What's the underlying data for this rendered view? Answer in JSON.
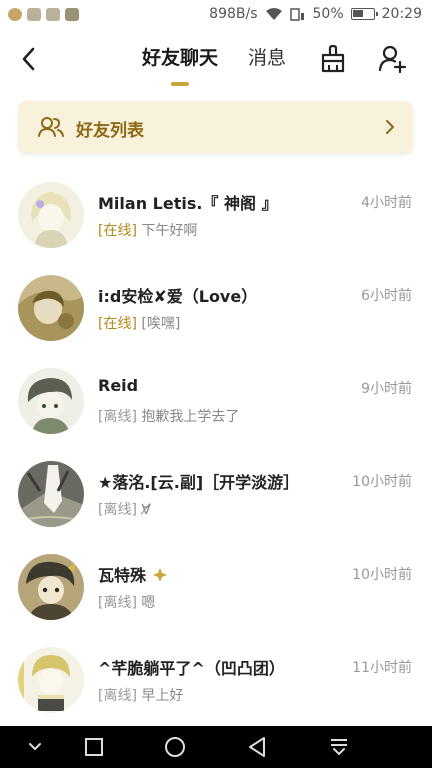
{
  "status_bar": {
    "speed": "898B/s",
    "battery": "50%",
    "time": "20:29"
  },
  "header": {
    "tabs": [
      {
        "label": "好友聊天",
        "active": true
      },
      {
        "label": "消息",
        "active": false
      }
    ],
    "icons": [
      "back-arrow-icon",
      "broom-icon",
      "add-user-icon"
    ]
  },
  "friends_banner": {
    "label": "好友列表",
    "icon": "friends-icon"
  },
  "chats": [
    {
      "name": "Milan Letis.『 神阁 』",
      "time": "4小时前",
      "status": "[在线]",
      "online": true,
      "message": "下午好啊"
    },
    {
      "name": "i:d安检✘爱（Love）",
      "time": "6小时前",
      "status": "[在线]",
      "online": true,
      "message": "[唉嘿]"
    },
    {
      "name": "Reid",
      "time": "9小时前",
      "status": "[离线]",
      "online": false,
      "message": "抱歉我上学去了"
    },
    {
      "name": "★落洺.[云.副]［开学淡游］",
      "time": "10小时前",
      "status": "[离线]",
      "online": false,
      "message": "∀̸"
    },
    {
      "name": "瓦特殊",
      "time": "10小时前",
      "status": "[离线]",
      "online": false,
      "message": "嗯"
    },
    {
      "name": "^芊脆躺平了^（凹凸团）",
      "time": "11小时前",
      "status": "[离线]",
      "online": false,
      "message": "早上好"
    }
  ],
  "colors": {
    "accent": "#c9a63a",
    "online": "#b08a1a",
    "banner_bg": "#f8f2dc",
    "banner_text": "#8c6a14"
  }
}
